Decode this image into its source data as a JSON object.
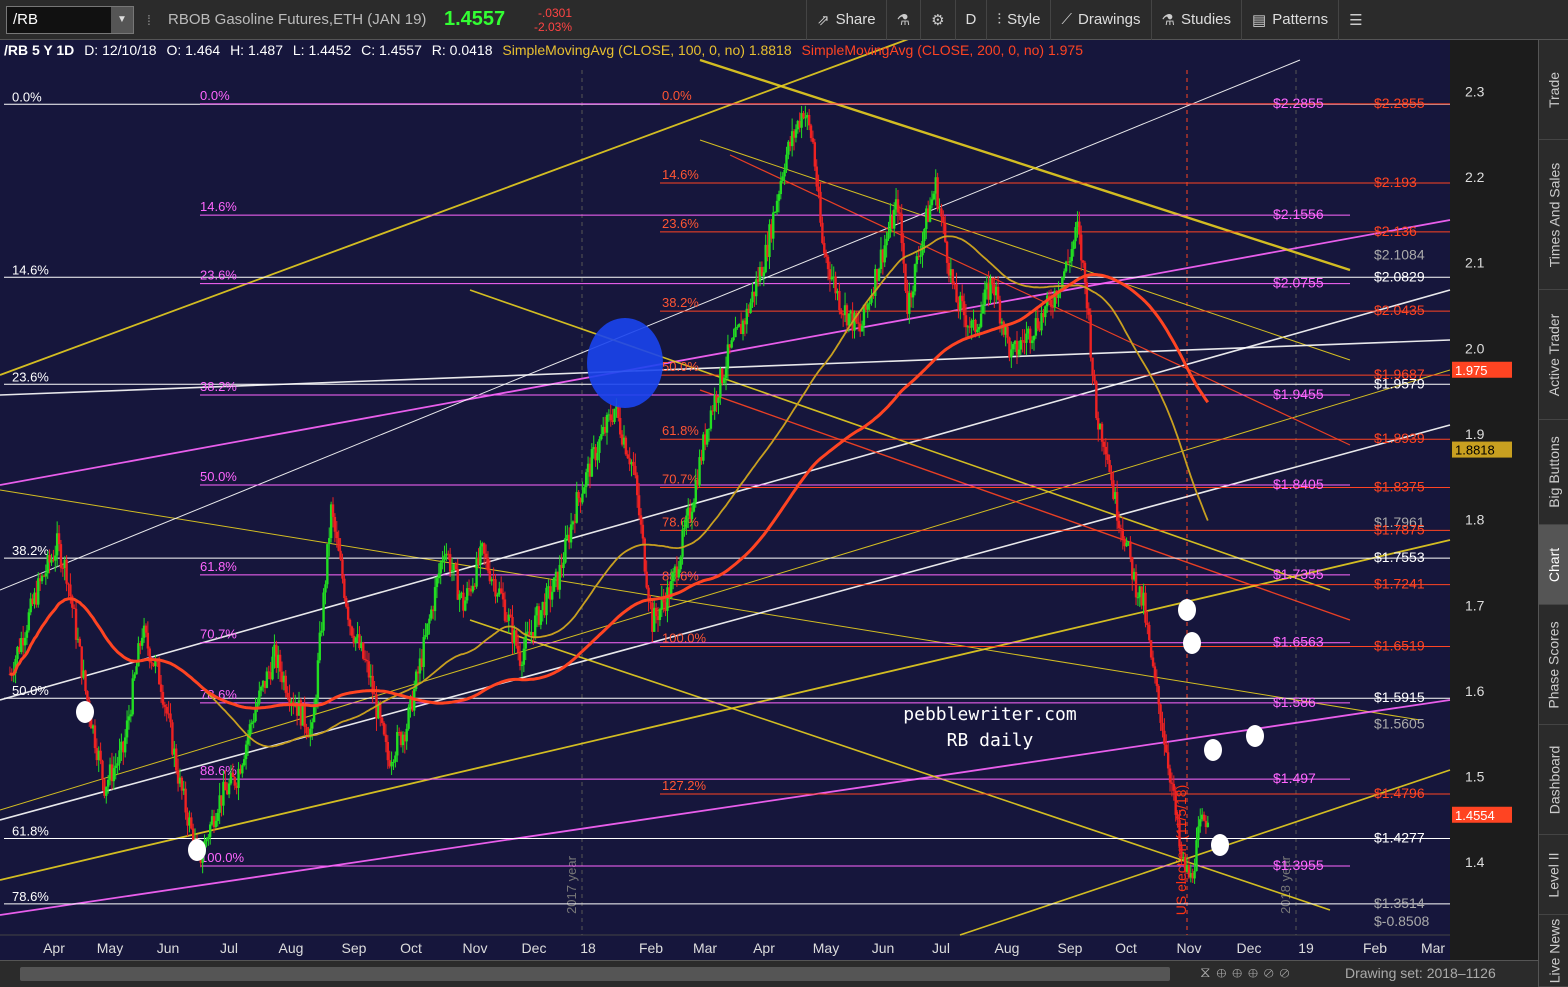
{
  "toolbar": {
    "symbol": "/RB",
    "description": "RBOB Gasoline Futures,ETH (JAN 19)",
    "last": "1.4557",
    "change": "-.0301",
    "change_pct": "-2.03%",
    "buttons": [
      {
        "icon": "share-icon",
        "glyph": "⇗",
        "label": "Share"
      },
      {
        "icon": "flask-icon",
        "glyph": "⚗",
        "label": ""
      },
      {
        "icon": "gear-icon",
        "glyph": "⚙",
        "label": ""
      },
      {
        "icon": "aggregation-icon",
        "glyph": "",
        "label": "D"
      },
      {
        "icon": "style-icon",
        "glyph": "⫶",
        "label": "Style"
      },
      {
        "icon": "drawings-icon",
        "glyph": "⟋",
        "label": "Drawings"
      },
      {
        "icon": "studies-icon",
        "glyph": "⚗",
        "label": "Studies"
      },
      {
        "icon": "patterns-icon",
        "glyph": "▤",
        "label": "Patterns"
      },
      {
        "icon": "menu-icon",
        "glyph": "☰",
        "label": ""
      }
    ]
  },
  "status": {
    "title": "/RB 5 Y 1D",
    "date": "D: 12/10/18",
    "open": "O: 1.464",
    "high": "H: 1.487",
    "low": "L: 1.4452",
    "close": "C: 1.4557",
    "range": "R: 0.0418",
    "sma100": "SimpleMovingAvg (CLOSE, 100, 0, no)",
    "sma100_val": "1.8818",
    "sma200": "SimpleMovingAvg (CLOSE, 200, 0, no)",
    "sma200_val": "1.975"
  },
  "right_tabs": [
    "Trade",
    "Times And Sales",
    "Active Trader",
    "Big Buttons",
    "Chart",
    "Phase Scores",
    "Dashboard",
    "Level II",
    "Live News"
  ],
  "active_tab": "Chart",
  "bottom": {
    "drawing_set": "Drawing set: 2018–1126",
    "icons": "⧖⊕⊕⊕⊘⊘"
  },
  "watermark": {
    "line1": "pebblewriter.com",
    "line2": "RB daily"
  },
  "annotations": {
    "election": "US election (11/5/18)",
    "year2017": "2017 year",
    "year2018": "2018 year"
  },
  "chart_data": {
    "type": "candlestick",
    "title": "/RB 5 Y 1D",
    "xlabel": "",
    "ylabel": "",
    "ylim": [
      1.32,
      2.32
    ],
    "x_ticks": [
      "Apr",
      "May",
      "Jun",
      "Jul",
      "Aug",
      "Sep",
      "Oct",
      "Nov",
      "Dec",
      "18",
      "Feb",
      "Mar",
      "Apr",
      "May",
      "Jun",
      "Jul",
      "Aug",
      "Sep",
      "Oct",
      "Nov",
      "Dec",
      "19",
      "Feb",
      "Mar"
    ],
    "y_ticks": [
      1.4,
      1.5,
      1.6,
      1.7,
      1.8,
      1.9,
      2.0,
      2.1,
      2.2,
      2.3
    ],
    "series": [
      {
        "name": "SimpleMovingAvg (CLOSE, 100, 0, no)",
        "last": 1.8818,
        "color": "#c8a020"
      },
      {
        "name": "SimpleMovingAvg (CLOSE, 200, 0, no)",
        "last": 1.975,
        "color": "#ff4422"
      }
    ],
    "price_path": [
      [
        0,
        1.62
      ],
      [
        3,
        1.72
      ],
      [
        5,
        1.77
      ],
      [
        6,
        1.74
      ],
      [
        8,
        1.6
      ],
      [
        10,
        1.49
      ],
      [
        12,
        1.53
      ],
      [
        14,
        1.67
      ],
      [
        16,
        1.61
      ],
      [
        18,
        1.49
      ],
      [
        20,
        1.4
      ],
      [
        22,
        1.47
      ],
      [
        24,
        1.5
      ],
      [
        26,
        1.58
      ],
      [
        28,
        1.64
      ],
      [
        30,
        1.59
      ],
      [
        32,
        1.55
      ],
      [
        34,
        1.81
      ],
      [
        36,
        1.68
      ],
      [
        38,
        1.62
      ],
      [
        40,
        1.52
      ],
      [
        42,
        1.56
      ],
      [
        44,
        1.66
      ],
      [
        46,
        1.77
      ],
      [
        48,
        1.7
      ],
      [
        50,
        1.76
      ],
      [
        52,
        1.71
      ],
      [
        54,
        1.64
      ],
      [
        56,
        1.69
      ],
      [
        58,
        1.73
      ],
      [
        60,
        1.82
      ],
      [
        62,
        1.88
      ],
      [
        64,
        1.93
      ],
      [
        66,
        1.86
      ],
      [
        68,
        1.68
      ],
      [
        70,
        1.72
      ],
      [
        72,
        1.81
      ],
      [
        74,
        1.92
      ],
      [
        76,
        1.99
      ],
      [
        78,
        2.04
      ],
      [
        80,
        2.11
      ],
      [
        82,
        2.22
      ],
      [
        84,
        2.28
      ],
      [
        85,
        2.24
      ],
      [
        86,
        2.12
      ],
      [
        88,
        2.05
      ],
      [
        90,
        2.02
      ],
      [
        92,
        2.1
      ],
      [
        94,
        2.17
      ],
      [
        95,
        2.05
      ],
      [
        97,
        2.15
      ],
      [
        98,
        2.19
      ],
      [
        100,
        2.06
      ],
      [
        102,
        2.02
      ],
      [
        104,
        2.08
      ],
      [
        106,
        1.99
      ],
      [
        108,
        2.02
      ],
      [
        110,
        2.05
      ],
      [
        112,
        2.1
      ],
      [
        113,
        2.14
      ],
      [
        114,
        2.06
      ],
      [
        115,
        1.92
      ],
      [
        116,
        1.89
      ],
      [
        117,
        1.82
      ],
      [
        118,
        1.78
      ],
      [
        119,
        1.73
      ],
      [
        120,
        1.7
      ],
      [
        121,
        1.62
      ],
      [
        122,
        1.56
      ],
      [
        123,
        1.49
      ],
      [
        124,
        1.4
      ],
      [
        125,
        1.38
      ],
      [
        126,
        1.44
      ],
      [
        127,
        1.46
      ]
    ],
    "fib_retracements_left": [
      {
        "label": "0.0%",
        "value": 2.285
      },
      {
        "label": "14.6%",
        "value": 2.083
      },
      {
        "label": "23.6%",
        "value": 1.958
      },
      {
        "label": "38.2%",
        "value": 1.755
      },
      {
        "label": "50.0%",
        "value": 1.5915
      },
      {
        "label": "61.8%",
        "value": 1.4277
      },
      {
        "label": "78.6%",
        "value": 1.3514
      }
    ],
    "fib_retracements_magenta": [
      {
        "label": "0.0%",
        "value": 2.2855
      },
      {
        "label": "14.6%",
        "value": 2.1556
      },
      {
        "label": "23.6%",
        "value": 2.0755
      },
      {
        "label": "38.2%",
        "value": 1.9455
      },
      {
        "label": "50.0%",
        "value": 1.8405
      },
      {
        "label": "61.8%",
        "value": 1.7355
      },
      {
        "label": "70.7%",
        "value": 1.6563
      },
      {
        "label": "78.6%",
        "value": 1.586
      },
      {
        "label": "88.6%",
        "value": 1.497
      },
      {
        "label": "100.0%",
        "value": 1.3955
      }
    ],
    "fib_retracements_red": [
      {
        "label": "0.0%",
        "value": 2.2855
      },
      {
        "label": "14.6%",
        "value": 2.193
      },
      {
        "label": "23.6%",
        "value": 2.136
      },
      {
        "label": "38.2%",
        "value": 2.0435
      },
      {
        "label": "50.0%",
        "value": 1.9687
      },
      {
        "label": "61.8%",
        "value": 1.8939
      },
      {
        "label": "70.7%",
        "value": 1.8375
      },
      {
        "label": "78.6%",
        "value": 1.7875
      },
      {
        "label": "88.6%",
        "value": 1.7241
      },
      {
        "label": "100.0%",
        "value": 1.6519
      },
      {
        "label": "127.2%",
        "value": 1.4796
      }
    ],
    "price_labels": [
      {
        "text": "$2.2855",
        "value": 2.2855,
        "color": "#ff66ff"
      },
      {
        "text": "$2.2855",
        "value": 2.2855,
        "color": "#ff4422"
      },
      {
        "text": "$2.193",
        "value": 2.193,
        "color": "#ff4422"
      },
      {
        "text": "$2.1556",
        "value": 2.1556,
        "color": "#ff66ff"
      },
      {
        "text": "$2.136",
        "value": 2.136,
        "color": "#ff4422"
      },
      {
        "text": "$2.1084",
        "value": 2.1084,
        "color": "#aaaaaa"
      },
      {
        "text": "$2.0829",
        "value": 2.0829,
        "color": "#ffffff"
      },
      {
        "text": "$2.0755",
        "value": 2.0755,
        "color": "#ff66ff"
      },
      {
        "text": "$2.0435",
        "value": 2.0435,
        "color": "#ff4422"
      },
      {
        "text": "$1.9687",
        "value": 1.9687,
        "color": "#ff4422"
      },
      {
        "text": "$1.9579",
        "value": 1.9579,
        "color": "#ffffff"
      },
      {
        "text": "$1.9455",
        "value": 1.9455,
        "color": "#ff66ff"
      },
      {
        "text": "$1.8939",
        "value": 1.8939,
        "color": "#ff4422"
      },
      {
        "text": "$1.8405",
        "value": 1.8405,
        "color": "#ff66ff"
      },
      {
        "text": "$1.8375",
        "value": 1.8375,
        "color": "#ff4422"
      },
      {
        "text": "$1.7961",
        "value": 1.7961,
        "color": "#aaaaaa"
      },
      {
        "text": "$1.7875",
        "value": 1.7875,
        "color": "#ff4422"
      },
      {
        "text": "$1.7553",
        "value": 1.7553,
        "color": "#ffffff"
      },
      {
        "text": "$1.7355",
        "value": 1.7355,
        "color": "#ff66ff"
      },
      {
        "text": "$1.7241",
        "value": 1.7241,
        "color": "#ff4422"
      },
      {
        "text": "$1.6563",
        "value": 1.6563,
        "color": "#ff66ff"
      },
      {
        "text": "$1.6519",
        "value": 1.6519,
        "color": "#ff4422"
      },
      {
        "text": "$1.5915",
        "value": 1.5915,
        "color": "#ffffff"
      },
      {
        "text": "$1.586",
        "value": 1.586,
        "color": "#ff66ff"
      },
      {
        "text": "$1.5605",
        "value": 1.5605,
        "color": "#aaaaaa"
      },
      {
        "text": "$1.497",
        "value": 1.497,
        "color": "#ff66ff"
      },
      {
        "text": "$1.4796",
        "value": 1.4796,
        "color": "#ff4422"
      },
      {
        "text": "$1.4277",
        "value": 1.4277,
        "color": "#ffffff"
      },
      {
        "text": "$1.3955",
        "value": 1.3955,
        "color": "#ff66ff"
      },
      {
        "text": "$1.3514",
        "value": 1.3514,
        "color": "#aaaaaa"
      },
      {
        "text": "$-0.8508",
        "value": 1.33,
        "color": "#aaaaaa"
      }
    ],
    "axis_markers": [
      {
        "text": "1.975",
        "value": 1.975,
        "bg": "#ff4422",
        "fg": "#ffffff"
      },
      {
        "text": "1.8818",
        "value": 1.8818,
        "bg": "#c8a020",
        "fg": "#000000"
      },
      {
        "text": "1.4554",
        "value": 1.4554,
        "bg": "#ff4422",
        "fg": "#ffffff"
      }
    ],
    "grid": false
  }
}
